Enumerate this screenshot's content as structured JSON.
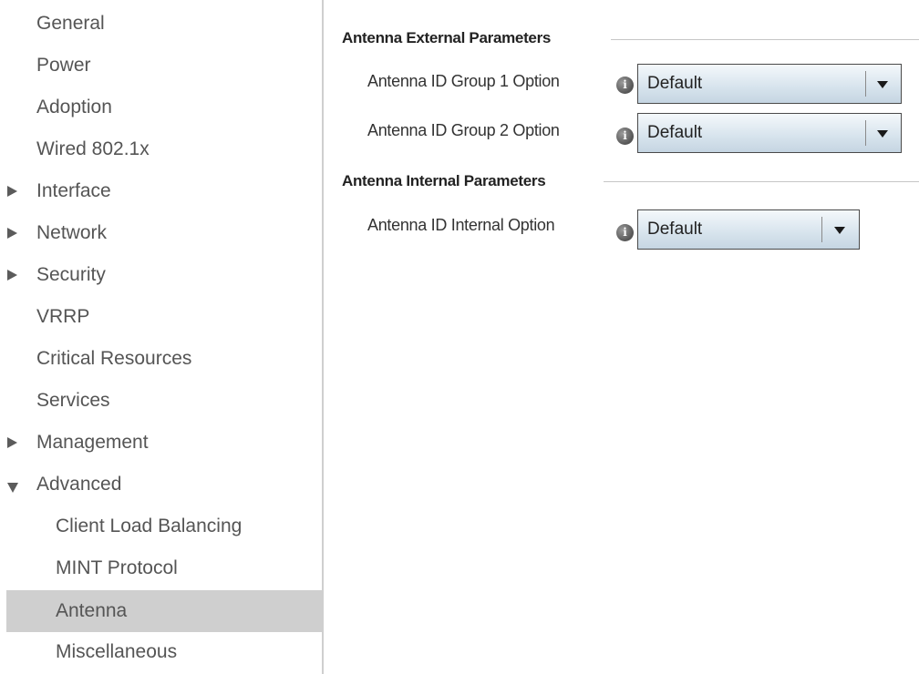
{
  "sidebar": {
    "items": [
      {
        "label": "General"
      },
      {
        "label": "Power"
      },
      {
        "label": "Adoption"
      },
      {
        "label": "Wired 802.1x"
      },
      {
        "label": "Interface",
        "expander": "collapsed"
      },
      {
        "label": "Network",
        "expander": "collapsed"
      },
      {
        "label": "Security",
        "expander": "collapsed"
      },
      {
        "label": "VRRP"
      },
      {
        "label": "Critical Resources"
      },
      {
        "label": "Services"
      },
      {
        "label": "Management",
        "expander": "collapsed"
      },
      {
        "label": "Advanced",
        "expander": "expanded"
      },
      {
        "label": "Client Load Balancing"
      },
      {
        "label": "MINT Protocol"
      },
      {
        "label": "Antenna",
        "selected": true
      },
      {
        "label": "Miscellaneous"
      }
    ]
  },
  "main": {
    "external": {
      "title": "Antenna External Parameters",
      "group1": {
        "label": "Antenna ID Group 1 Option",
        "value": "Default"
      },
      "group2": {
        "label": "Antenna ID Group 2 Option",
        "value": "Default"
      }
    },
    "internal": {
      "title": "Antenna Internal Parameters",
      "option": {
        "label": "Antenna ID Internal Option",
        "value": "Default"
      }
    }
  },
  "colors": {
    "selected_nav_bg": "#cfcfcf",
    "select_gradient_top": "#f4f8fb",
    "select_gradient_bottom": "#c5d5e2"
  },
  "icons": {
    "info": "info-icon",
    "collapsed": "triangle-right-icon",
    "expanded": "triangle-down-icon",
    "dropdown": "caret-down-icon"
  }
}
